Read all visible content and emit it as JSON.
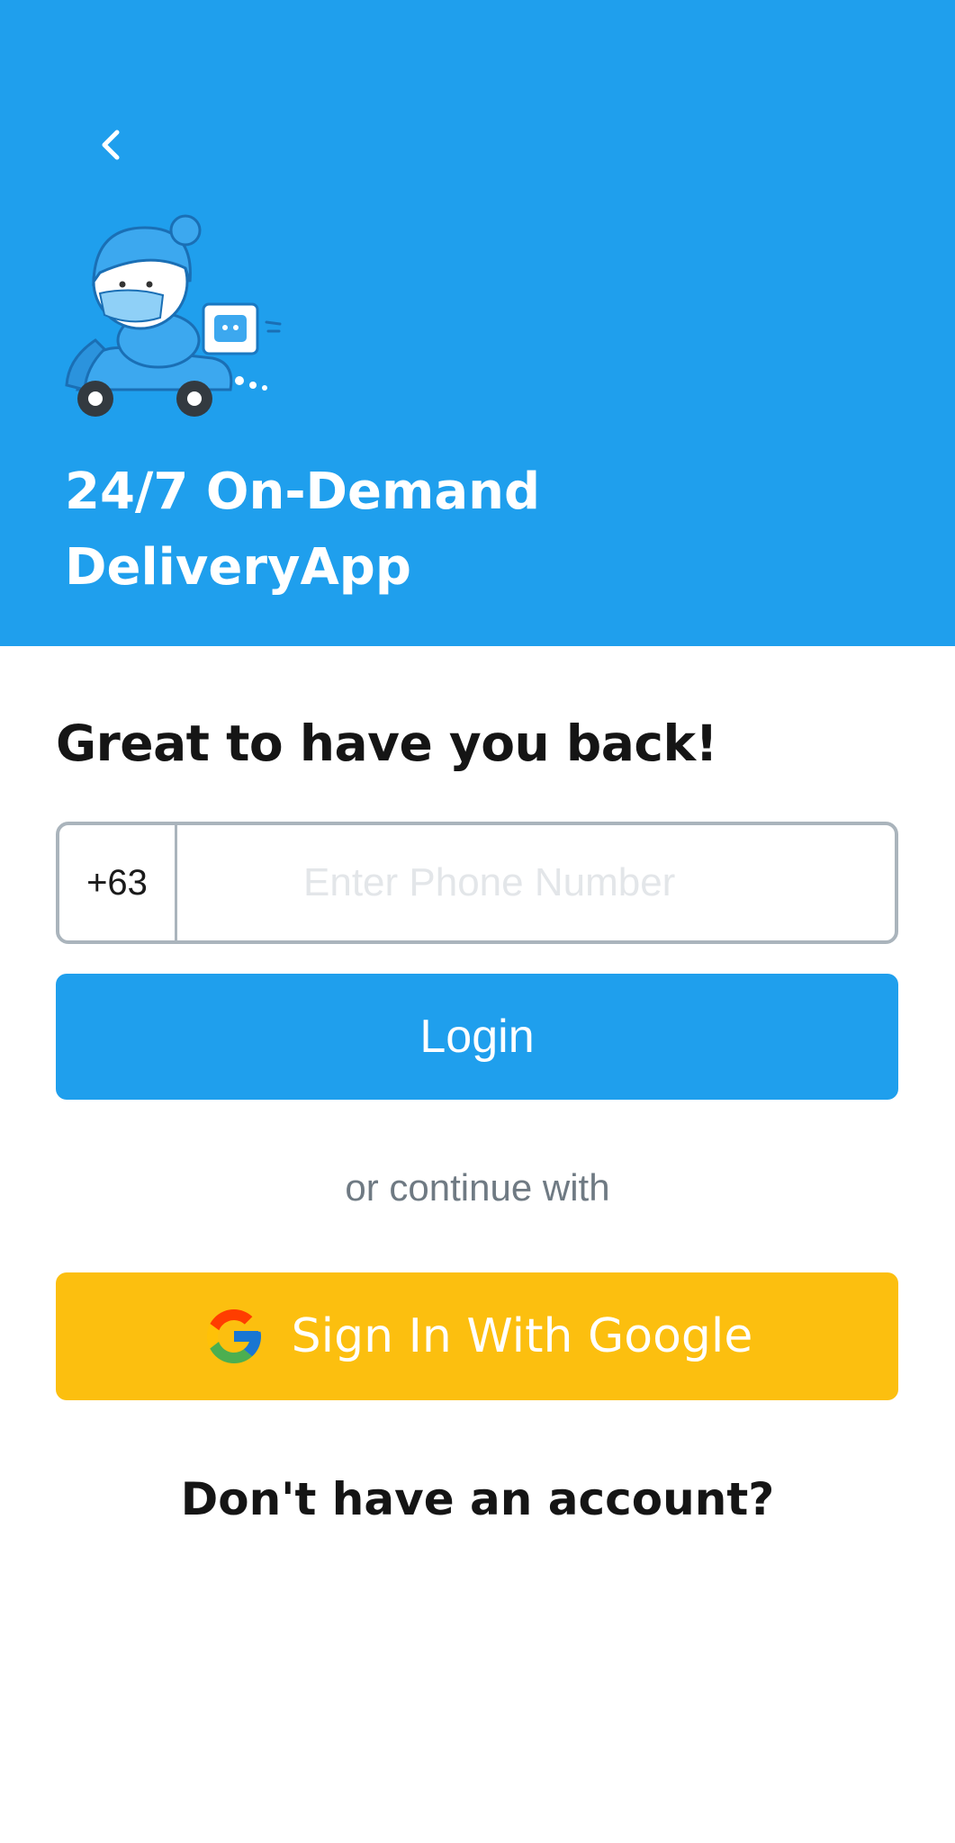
{
  "header": {
    "back_icon": "chevron-left-icon",
    "mascot_icon": "delivery-scooter-mascot-icon",
    "title_line1": "24/7 On-Demand",
    "title_line2": "DeliveryApp",
    "background_color": "#1f9fed"
  },
  "login": {
    "welcome": "Great to have you back!",
    "country_code": "+63",
    "phone_value": "",
    "phone_placeholder": "Enter Phone Number",
    "login_label": "Login",
    "login_color": "#1f9fed",
    "or_text": "or continue with",
    "google_icon": "google-g-icon",
    "google_label": "Sign In With Google",
    "google_color": "#fcbf0f",
    "signup_prompt": "Don't have an account?"
  }
}
